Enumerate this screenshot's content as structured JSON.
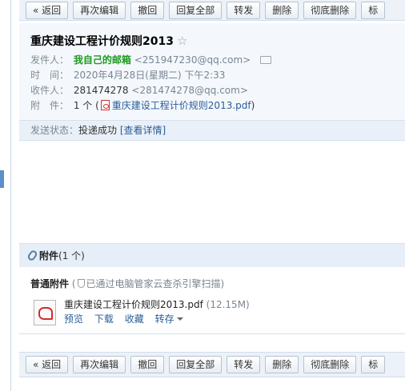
{
  "toolbar": {
    "buttons": [
      "« 返回",
      "再次编辑",
      "撤回",
      "回复全部",
      "转发",
      "删除",
      "彻底删除",
      "标"
    ]
  },
  "mail": {
    "subject": "重庆建设工程计价规则2013",
    "star": "☆",
    "from_label": "发件人：",
    "from_name": "我自己的邮箱",
    "from_addr": "<251947230@qq.com>",
    "time_label": "时　间：",
    "time_value": "2020年4月28日(星期二) 下午2:33",
    "to_label": "收件人：",
    "to_name": "281474278",
    "to_addr": "<281474278@qq.com>",
    "attach_label": "附　件：",
    "attach_count": "1 个 (",
    "attach_file": "重庆建设工程计价规则2013.pdf",
    "attach_close": ")"
  },
  "status": {
    "label": "发送状态：",
    "value": "投递成功",
    "detail_link": "[查看详情]"
  },
  "attachments": {
    "title": "附件",
    "count": "(1 个)",
    "section_label": "普通附件",
    "scan_open": "(",
    "scan_text": "已通过电脑管家云查杀引擎扫描",
    "scan_close": ")",
    "file_name": "重庆建设工程计价规则2013.pdf",
    "file_size": "(12.15M)",
    "actions": [
      "预览",
      "下载",
      "收藏",
      "转存"
    ]
  },
  "icons": {
    "star": "star-icon",
    "card": "contact-card-icon",
    "pdf": "pdf-icon",
    "clip": "paperclip-icon",
    "shield": "shield-icon"
  },
  "colors": {
    "sender_green": "#1e9a1e",
    "link_blue": "#2b5d99",
    "header_bg": "#f4f8fc",
    "toolbar_bg": "#ecf2f8"
  }
}
